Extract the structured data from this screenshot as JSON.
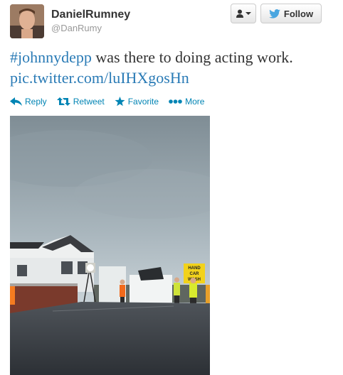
{
  "tweet": {
    "display_name": "DanielRumney",
    "screen_name": "@DanRumy",
    "hashtag": "#johnnydepp",
    "text_body": " was there to doing acting work. ",
    "link": "pic.twitter.com/luIHXgosHn"
  },
  "header": {
    "follow_label": "Follow"
  },
  "actions": {
    "reply_label": "Reply",
    "retweet_label": "Retweet",
    "favorite_label": "Favorite",
    "more_label": "More"
  },
  "photo": {
    "sign_text": "HAND CAR WASH"
  },
  "colors": {
    "link": "#2a7bb6",
    "action": "#0084b4",
    "twitter_bird": "#4aa6e0"
  },
  "icons": [
    "user-icon",
    "caret-down-icon",
    "twitter-bird-icon",
    "reply-icon",
    "retweet-icon",
    "star-icon",
    "more-dots-icon"
  ]
}
